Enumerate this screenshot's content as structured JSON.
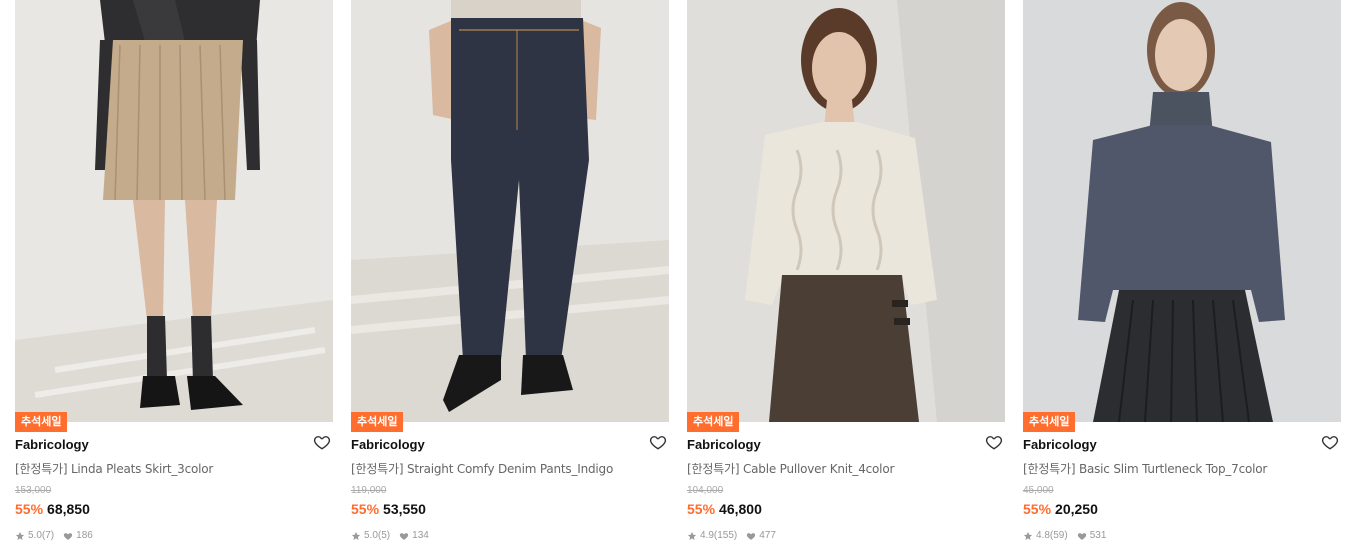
{
  "products": [
    {
      "badge": "추석세일",
      "brand": "Fabricology",
      "name": "[한정특가] Linda Pleats Skirt_3color",
      "original_price": "153,000",
      "discount": "55%",
      "price": "68,850",
      "rating": "5.0",
      "reviews": "(7)",
      "likes": "186",
      "image_icon": "model-pleated-skirt-image"
    },
    {
      "badge": "추석세일",
      "brand": "Fabricology",
      "name": "[한정특가] Straight Comfy Denim Pants_Indigo",
      "original_price": "119,000",
      "discount": "55%",
      "price": "53,550",
      "rating": "5.0",
      "reviews": "(5)",
      "likes": "134",
      "image_icon": "model-denim-pants-image"
    },
    {
      "badge": "추석세일",
      "brand": "Fabricology",
      "name": "[한정특가] Cable Pullover Knit_4color",
      "original_price": "104,000",
      "discount": "55%",
      "price": "46,800",
      "rating": "4.9",
      "reviews": "(155)",
      "likes": "477",
      "image_icon": "model-cable-knit-image"
    },
    {
      "badge": "추석세일",
      "brand": "Fabricology",
      "name": "[한정특가] Basic Slim Turtleneck Top_7color",
      "original_price": "45,000",
      "discount": "55%",
      "price": "20,250",
      "rating": "4.8",
      "reviews": "(59)",
      "likes": "531",
      "image_icon": "model-turtleneck-image"
    }
  ],
  "colors": {
    "accent": "#ff6e2e",
    "text": "#111111",
    "muted": "#999999"
  }
}
